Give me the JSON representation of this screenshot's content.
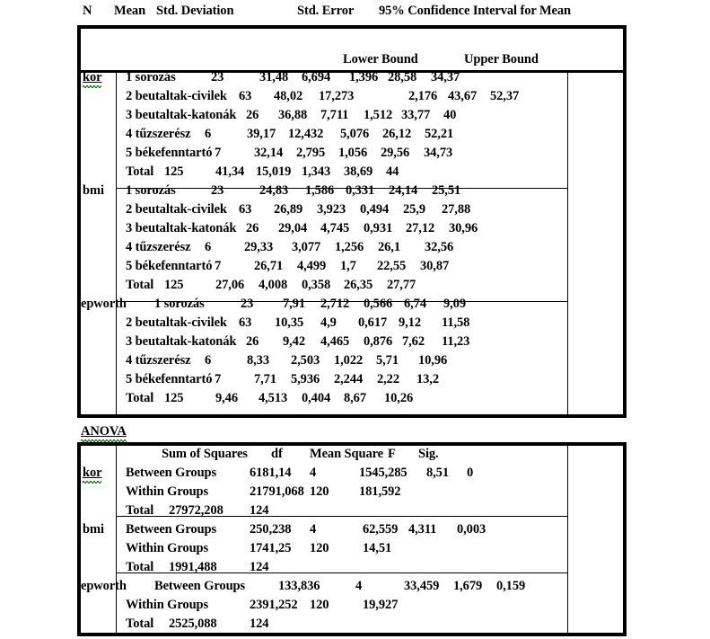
{
  "document": {
    "type": "spss-statistics-output",
    "tables": [
      {
        "name": "descriptives",
        "headers": {
          "n": "N",
          "mean": "Mean",
          "std_deviation": "Std. Deviation",
          "std_error": "Std. Error",
          "confidence_interval": "95% Confidence Interval for Mean",
          "lower_bound": "Lower Bound",
          "upper_bound": "Upper Bound"
        },
        "groups": [
          {
            "label": "kor",
            "spellcheck_flag": true,
            "rows": [
              {
                "group": "1 sorozás",
                "n": "23",
                "mean": "31,48",
                "sd": "6,694",
                "se": "1,396",
                "lower": "28,58",
                "upper": "34,37"
              },
              {
                "group": "2 beutaltak-civilek",
                "n": "63",
                "mean": "48,02",
                "sd": "17,273",
                "se": "2,176",
                "lower": "43,67",
                "upper": "52,37"
              },
              {
                "group": "3 beutaltak-katonák",
                "n": "26",
                "mean": "36,88",
                "sd": "7,711",
                "se": "1,512",
                "lower": "33,77",
                "upper": "40"
              },
              {
                "group": "4 tűzszerész",
                "n": "6",
                "mean": "39,17",
                "sd": "12,432",
                "se": "5,076",
                "lower": "26,12",
                "upper": "52,21"
              },
              {
                "group": "5 békefenntartó",
                "n": "7",
                "mean": "32,14",
                "sd": "2,795",
                "se": "1,056",
                "lower": "29,56",
                "upper": "34,73"
              },
              {
                "group": "Total",
                "n": "125",
                "mean": "41,34",
                "sd": "15,019",
                "se": "1,343",
                "lower": "38,69",
                "upper": "44"
              }
            ]
          },
          {
            "label": "bmi",
            "spellcheck_flag": false,
            "rows": [
              {
                "group": "1 sorozás",
                "n": "23",
                "mean": "24,83",
                "sd": "1,586",
                "se": "0,331",
                "lower": "24,14",
                "upper": "25,51"
              },
              {
                "group": "2 beutaltak-civilek",
                "n": "63",
                "mean": "26,89",
                "sd": "3,923",
                "se": "0,494",
                "lower": "25,9",
                "upper": "27,88"
              },
              {
                "group": "3 beutaltak-katonák",
                "n": "26",
                "mean": "29,04",
                "sd": "4,745",
                "se": "0,931",
                "lower": "27,12",
                "upper": "30,96"
              },
              {
                "group": "4 tűzszerész",
                "n": "6",
                "mean": "29,33",
                "sd": "3,077",
                "se": "1,256",
                "lower": "26,1",
                "upper": "32,56"
              },
              {
                "group": "5 békefenntartó",
                "n": "7",
                "mean": "26,71",
                "sd": "4,499",
                "se": "1,7",
                "lower": "22,55",
                "upper": "30,87"
              },
              {
                "group": "Total",
                "n": "125",
                "mean": "27,06",
                "sd": "4,008",
                "se": "0,358",
                "lower": "26,35",
                "upper": "27,77"
              }
            ]
          },
          {
            "label": "epworth",
            "spellcheck_flag": false,
            "rows": [
              {
                "group": "1 sorozás",
                "n": "23",
                "mean": "7,91",
                "sd": "2,712",
                "se": "0,566",
                "lower": "6,74",
                "upper": "9,09"
              },
              {
                "group": "2 beutaltak-civilek",
                "n": "63",
                "mean": "10,35",
                "sd": "4,9",
                "se": "0,617",
                "lower": "9,12",
                "upper": "11,58"
              },
              {
                "group": "3 beutaltak-katonák",
                "n": "26",
                "mean": "9,42",
                "sd": "4,465",
                "se": "0,876",
                "lower": "7,62",
                "upper": "11,23"
              },
              {
                "group": "4 tűzszerész",
                "n": "6",
                "mean": "8,33",
                "sd": "2,503",
                "se": "1,022",
                "lower": "5,71",
                "upper": "10,96"
              },
              {
                "group": "5 békefenntartó",
                "n": "7",
                "mean": "7,71",
                "sd": "5,936",
                "se": "2,244",
                "lower": "2,22",
                "upper": "13,2"
              },
              {
                "group": "Total",
                "n": "125",
                "mean": "9,46",
                "sd": "4,513",
                "se": "0,404",
                "lower": "8,67",
                "upper": "10,26"
              }
            ]
          }
        ]
      },
      {
        "name": "anova",
        "title": "ANOVA",
        "title_spellcheck_flag": true,
        "headers": {
          "sum_of_squares": "Sum of Squares",
          "df": "df",
          "mean_square": "Mean Square",
          "f": "F",
          "sig": "Sig."
        },
        "groups": [
          {
            "label": "kor",
            "spellcheck_flag": true,
            "rows": [
              {
                "source": "Between Groups",
                "ss": "6181,14",
                "df": "4",
                "ms": "1545,285",
                "f": "8,51",
                "sig": "0"
              },
              {
                "source": "Within Groups",
                "ss": "21791,068",
                "df": "120",
                "ms": "181,592",
                "f": "",
                "sig": ""
              },
              {
                "source": "Total",
                "ss": "27972,208",
                "df": "124",
                "ms": "",
                "f": "",
                "sig": ""
              }
            ]
          },
          {
            "label": "bmi",
            "spellcheck_flag": false,
            "rows": [
              {
                "source": "Between Groups",
                "ss": "250,238",
                "df": "4",
                "ms": "62,559",
                "f": "4,311",
                "sig": "0,003"
              },
              {
                "source": "Within Groups",
                "ss": "1741,25",
                "df": "120",
                "ms": "14,51",
                "f": "",
                "sig": ""
              },
              {
                "source": "Total",
                "ss": "1991,488",
                "df": "124",
                "ms": "",
                "f": "",
                "sig": ""
              }
            ]
          },
          {
            "label": "epworth",
            "spellcheck_flag": false,
            "rows": [
              {
                "source": "Between Groups",
                "ss": "133,836",
                "df": "4",
                "ms": "33,459",
                "f": "1,679",
                "sig": "0,159"
              },
              {
                "source": "Within Groups",
                "ss": "2391,252",
                "df": "120",
                "ms": "19,927",
                "f": "",
                "sig": ""
              },
              {
                "source": "Total",
                "ss": "2525,088",
                "df": "124",
                "ms": "",
                "f": "",
                "sig": ""
              }
            ]
          }
        ]
      }
    ]
  }
}
